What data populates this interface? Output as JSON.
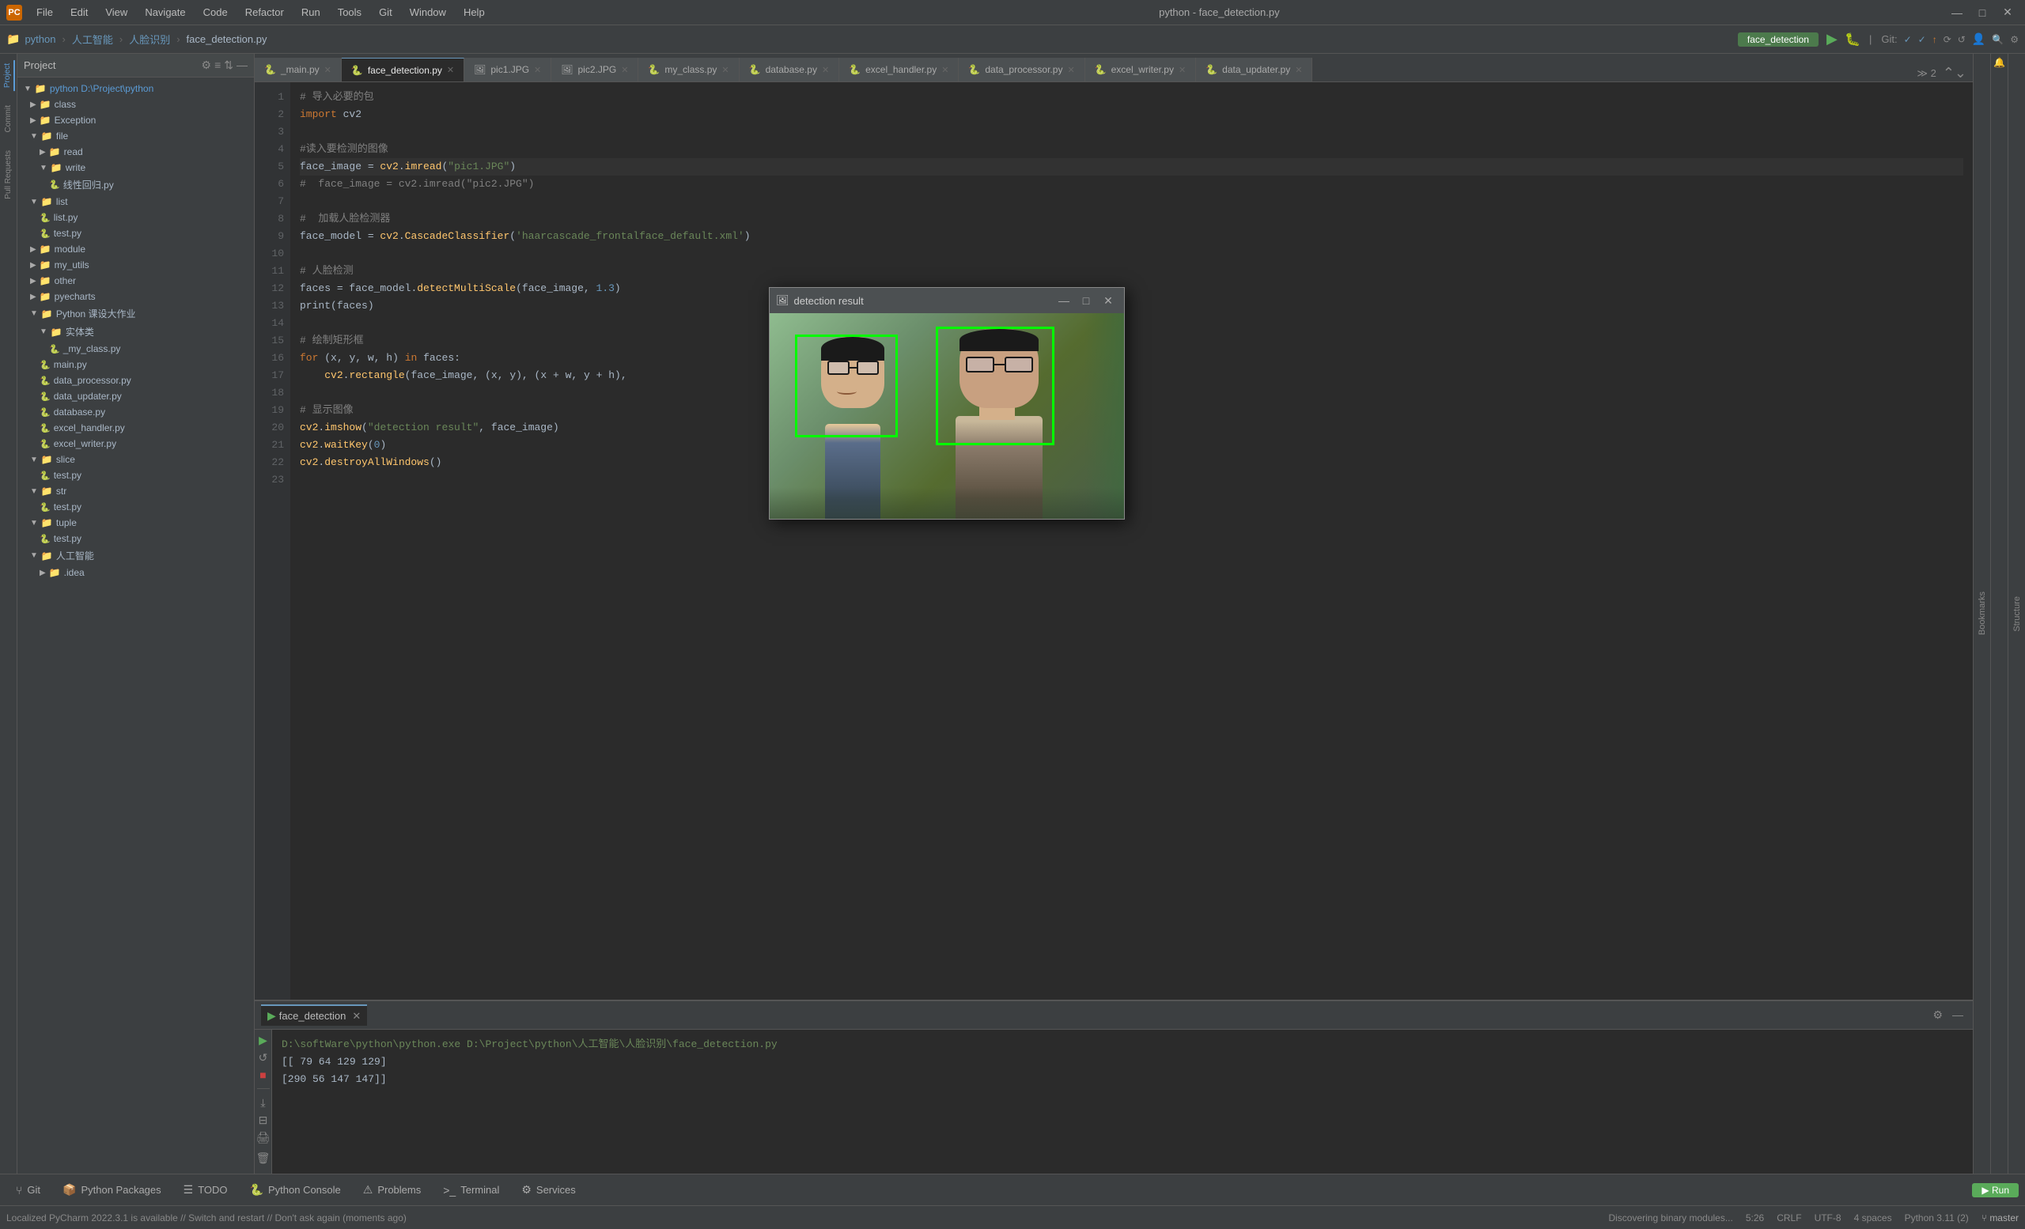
{
  "app": {
    "title": "python - face_detection.py",
    "icon_text": "PC"
  },
  "menu": {
    "items": [
      "File",
      "Edit",
      "View",
      "Navigate",
      "Code",
      "Refactor",
      "Run",
      "Tools",
      "Git",
      "Window",
      "Help"
    ]
  },
  "toolbar": {
    "breadcrumbs": [
      "python",
      "人工智能",
      "人脸识别",
      "face_detection.py"
    ]
  },
  "tabs": [
    {
      "label": "_main.py",
      "active": false
    },
    {
      "label": "face_detection.py",
      "active": true
    },
    {
      "label": "pic1.JPG",
      "active": false
    },
    {
      "label": "pic2.JPG",
      "active": false
    },
    {
      "label": "my_class.py",
      "active": false
    },
    {
      "label": "database.py",
      "active": false
    },
    {
      "label": "excel_handler.py",
      "active": false
    },
    {
      "label": "data_processor.py",
      "active": false
    },
    {
      "label": "excel_writer.py",
      "active": false
    },
    {
      "label": "data_updater.py",
      "active": false
    }
  ],
  "project_panel": {
    "title": "Project",
    "root": "python D:\\Project\\python",
    "tree": [
      {
        "indent": 1,
        "type": "folder",
        "label": "class",
        "expanded": false
      },
      {
        "indent": 1,
        "type": "folder",
        "label": "Exception",
        "expanded": false
      },
      {
        "indent": 1,
        "type": "folder",
        "label": "file",
        "expanded": true
      },
      {
        "indent": 2,
        "type": "folder",
        "label": "read",
        "expanded": false
      },
      {
        "indent": 2,
        "type": "folder",
        "label": "write",
        "expanded": true
      },
      {
        "indent": 3,
        "type": "file-py",
        "label": "线性回归.py"
      },
      {
        "indent": 1,
        "type": "folder",
        "label": "list",
        "expanded": true
      },
      {
        "indent": 2,
        "type": "file-py",
        "label": "list.py"
      },
      {
        "indent": 2,
        "type": "file-py",
        "label": "test.py"
      },
      {
        "indent": 1,
        "type": "folder",
        "label": "module",
        "expanded": false
      },
      {
        "indent": 1,
        "type": "folder",
        "label": "my_utils",
        "expanded": false
      },
      {
        "indent": 1,
        "type": "folder",
        "label": "other",
        "expanded": false
      },
      {
        "indent": 1,
        "type": "folder",
        "label": "pyecharts",
        "expanded": false
      },
      {
        "indent": 1,
        "type": "folder",
        "label": "Python 课设大作业",
        "expanded": true
      },
      {
        "indent": 2,
        "type": "folder",
        "label": "实体类",
        "expanded": true
      },
      {
        "indent": 3,
        "type": "file-py",
        "label": "_my_class.py"
      },
      {
        "indent": 2,
        "type": "file-py",
        "label": "main.py"
      },
      {
        "indent": 2,
        "type": "file-py",
        "label": "data_processor.py"
      },
      {
        "indent": 2,
        "type": "file-py",
        "label": "data_updater.py"
      },
      {
        "indent": 2,
        "type": "file-py",
        "label": "database.py"
      },
      {
        "indent": 2,
        "type": "file-py",
        "label": "excel_handler.py"
      },
      {
        "indent": 2,
        "type": "file-py",
        "label": "excel_writer.py"
      },
      {
        "indent": 1,
        "type": "folder",
        "label": "slice",
        "expanded": true
      },
      {
        "indent": 2,
        "type": "file-py",
        "label": "test.py"
      },
      {
        "indent": 1,
        "type": "folder",
        "label": "str",
        "expanded": true
      },
      {
        "indent": 2,
        "type": "file-py",
        "label": "test.py"
      },
      {
        "indent": 1,
        "type": "folder",
        "label": "tuple",
        "expanded": true
      },
      {
        "indent": 2,
        "type": "file-py",
        "label": "test.py"
      },
      {
        "indent": 1,
        "type": "folder",
        "label": "人工智能",
        "expanded": true
      },
      {
        "indent": 2,
        "type": "folder",
        "label": "idea",
        "expanded": false
      }
    ]
  },
  "code": {
    "lines": [
      {
        "num": 1,
        "text": "# 导入必要的包"
      },
      {
        "num": 2,
        "text": "import cv2"
      },
      {
        "num": 3,
        "text": ""
      },
      {
        "num": 4,
        "text": "#读入要检测的图像"
      },
      {
        "num": 5,
        "text": "face_image = cv2.imread(\"pic1.JPG\")"
      },
      {
        "num": 6,
        "text": "#  face_image = cv2.imread(\"pic2.JPG\")"
      },
      {
        "num": 7,
        "text": ""
      },
      {
        "num": 8,
        "text": "#  加载人脸检测器"
      },
      {
        "num": 9,
        "text": "face_model = cv2.CascadeClassifier('haarcascade_frontalface_default.xml')"
      },
      {
        "num": 10,
        "text": ""
      },
      {
        "num": 11,
        "text": "# 人脸检测"
      },
      {
        "num": 12,
        "text": "faces = face_model.detectMultiScale(face_image, 1.3)"
      },
      {
        "num": 13,
        "text": "print(faces)"
      },
      {
        "num": 14,
        "text": ""
      },
      {
        "num": 15,
        "text": "# 绘制矩形框"
      },
      {
        "num": 16,
        "text": "for (x, y, w, h) in faces:"
      },
      {
        "num": 17,
        "text": "    cv2.rectangle(face_image, (x, y), (x + w, y + h),"
      },
      {
        "num": 18,
        "text": ""
      },
      {
        "num": 19,
        "text": "# 显示图像"
      },
      {
        "num": 20,
        "text": "cv2.imshow(\"detection result\", face_image)"
      },
      {
        "num": 21,
        "text": "cv2.waitKey(0)"
      },
      {
        "num": 22,
        "text": "cv2.destroyAllWindows()"
      },
      {
        "num": 23,
        "text": ""
      }
    ]
  },
  "detection_window": {
    "title": "detection result",
    "icon": "🖼",
    "controls": [
      "—",
      "□",
      "✕"
    ]
  },
  "run_panel": {
    "tab_label": "face_detection",
    "command": "D:\\softWare\\python\\python.exe D:\\Project\\python\\人工智能\\人脸识别\\face_detection.py",
    "output_lines": [
      "[[ 79  64 129 129]",
      " [290  56 147 147]]"
    ]
  },
  "bottom_tabs": [
    {
      "label": "Git",
      "icon": "⑂",
      "active": false
    },
    {
      "label": "Python Packages",
      "icon": "📦",
      "active": false
    },
    {
      "label": "TODO",
      "icon": "☰",
      "active": false
    },
    {
      "label": "Python Console",
      "icon": "🐍",
      "active": false
    },
    {
      "label": "Problems",
      "icon": "⚠",
      "active": false
    },
    {
      "label": "Terminal",
      "icon": ">_",
      "active": false
    },
    {
      "label": "Services",
      "icon": "⚙",
      "active": false
    }
  ],
  "status_bar": {
    "left_message": "Localized PyCharm 2022.3.1 is available // Switch and restart // Don't ask again (moments ago)",
    "position": "5:26",
    "line_ending": "CRLF",
    "encoding": "UTF-8",
    "indent": "4 spaces",
    "python_version": "Python 3.11 (2)",
    "branch": "master",
    "run_button": "▶ Run"
  },
  "run_tab": {
    "label": "▶ Run"
  },
  "git_status": "master"
}
